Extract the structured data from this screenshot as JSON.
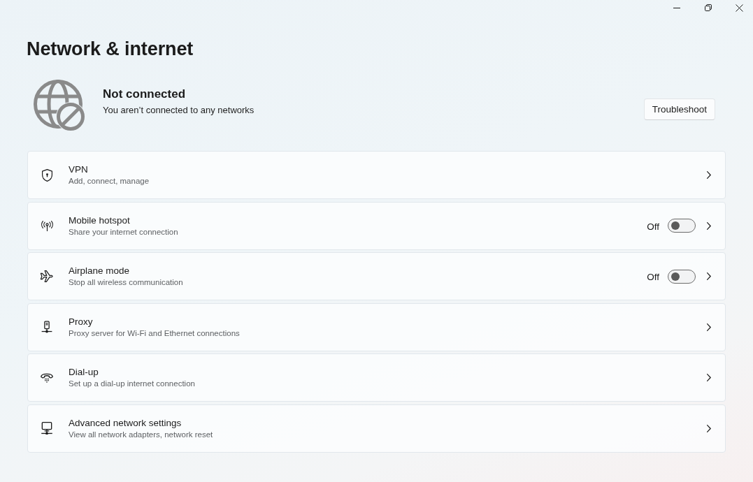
{
  "page": {
    "title": "Network & internet"
  },
  "status": {
    "title": "Not connected",
    "description": "You aren’t connected to any networks",
    "button": "Troubleshoot"
  },
  "settings": [
    {
      "kind": "link",
      "title": "VPN",
      "description": "Add, connect, manage"
    },
    {
      "kind": "toggle",
      "title": "Mobile hotspot",
      "description": "Share your internet connection",
      "state_label": "Off",
      "on": false
    },
    {
      "kind": "toggle",
      "title": "Airplane mode",
      "description": "Stop all wireless communication",
      "state_label": "Off",
      "on": false
    },
    {
      "kind": "link",
      "title": "Proxy",
      "description": "Proxy server for Wi-Fi and Ethernet connections"
    },
    {
      "kind": "link",
      "title": "Dial-up",
      "description": "Set up a dial-up internet connection"
    },
    {
      "kind": "link",
      "title": "Advanced network settings",
      "description": "View all network adapters, network reset"
    }
  ]
}
